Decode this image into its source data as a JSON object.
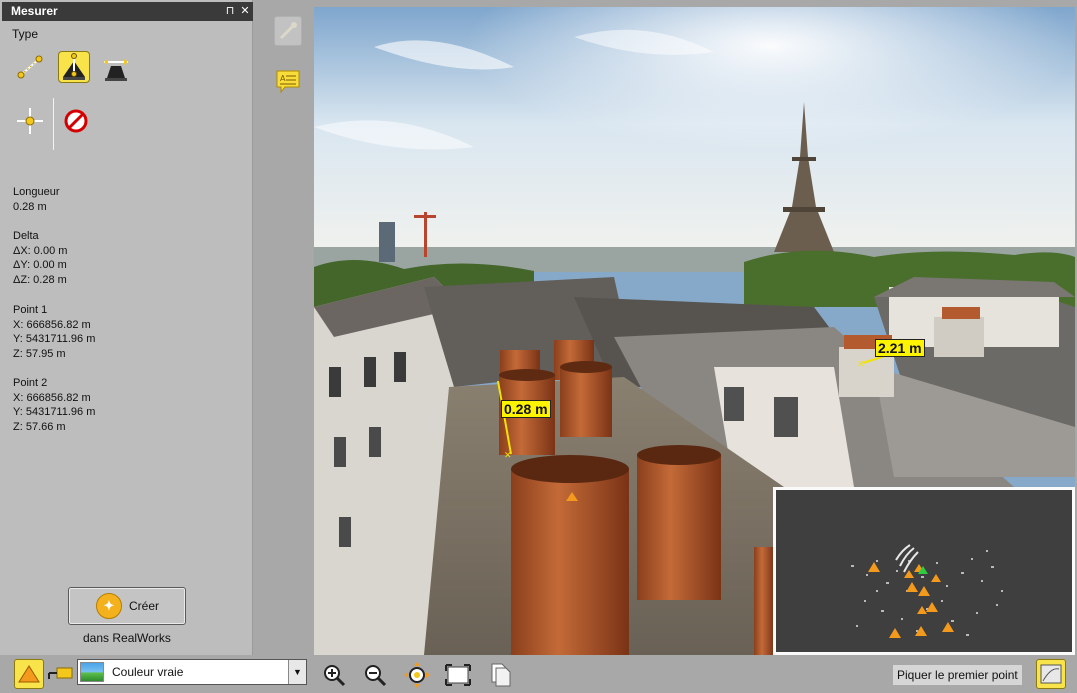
{
  "panel": {
    "title": "Mesurer",
    "pin_glyph": "⊓",
    "close_glyph": "✕",
    "type_label": "Type",
    "tools": [
      {
        "name": "distance-tool",
        "icon": "measure-line-icon",
        "active": false
      },
      {
        "name": "height-tool",
        "icon": "measure-height-icon",
        "active": true
      },
      {
        "name": "width-tool",
        "icon": "measure-width-icon",
        "active": false
      },
      {
        "name": "point-tool",
        "icon": "measure-point-icon",
        "active": false
      },
      {
        "name": "cancel-tool",
        "icon": "no-entry-icon",
        "active": false
      }
    ],
    "longueur": {
      "label": "Longueur",
      "value": "0.28 m"
    },
    "delta": {
      "label": "Delta",
      "dx": "ΔX: 0.00 m",
      "dy": "ΔY: 0.00 m",
      "dz": "ΔZ: 0.28 m"
    },
    "point1": {
      "label": "Point 1",
      "x": "X: 666856.82 m",
      "y": "Y: 5431711.96 m",
      "z": "Z: 57.95 m"
    },
    "point2": {
      "label": "Point 2",
      "x": "X: 666856.82 m",
      "y": "Y: 5431711.96 m",
      "z": "Z: 57.66 m"
    },
    "create_button": "Créer",
    "create_sub": "dans RealWorks"
  },
  "viewport": {
    "measure1": "0.28 m",
    "measure2": "2.21 m"
  },
  "bottombar": {
    "color_mode": "Couleur vraie",
    "status": "Piquer le premier point"
  },
  "colors": {
    "panel_bg": "#bdbdbd",
    "title_bg": "#3a3a3a",
    "label_yellow": "#fff400",
    "accent_orange": "#f39a1d",
    "active_tool": "#f8e44a"
  }
}
